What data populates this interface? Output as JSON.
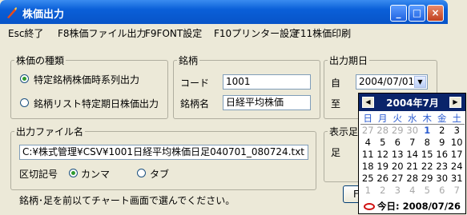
{
  "window": {
    "title": "株価出力",
    "min_label": "_",
    "max_label": "□",
    "close_label": "×"
  },
  "menu": {
    "items": [
      "Esc終了",
      "F8株価ファイル出力",
      "F9FONT設定",
      "F10プリンター設定",
      "F11株価印刷"
    ]
  },
  "stock_type": {
    "legend": "株価の種類",
    "option1": "特定銘柄株価時系列出力",
    "option2": "銘柄リスト特定期日株価出力",
    "selected": 0
  },
  "issue": {
    "legend": "銘柄",
    "code_label": "コード",
    "code_value": "1001",
    "name_label": "銘柄名",
    "name_value": "日経平均株価"
  },
  "period": {
    "legend": "出力期日",
    "from_label": "自",
    "from_value": "2004/07/01",
    "to_label": "至",
    "dropdown_arrow": "▼"
  },
  "display": {
    "legend": "表示足",
    "foot_label": "足"
  },
  "output_file": {
    "legend": "出力ファイル名",
    "path": "C:¥株式管理¥CSV¥1001日経平均株価日足040701_080724.txt",
    "delimiter_label": "区切記号",
    "comma": "カンマ",
    "tab": "タブ",
    "selected": "comma"
  },
  "status": {
    "message": "銘柄･足を前以てチャート画面で選んでください。"
  },
  "bottom_button": {
    "label": "F"
  },
  "calendar": {
    "title": "2004年7月",
    "prev": "◀",
    "next": "▶",
    "weekdays": [
      "日",
      "月",
      "火",
      "水",
      "木",
      "金",
      "土"
    ],
    "weeks": [
      [
        "27",
        "28",
        "29",
        "30",
        "1",
        "2",
        "3"
      ],
      [
        "4",
        "5",
        "6",
        "7",
        "8",
        "9",
        "10"
      ],
      [
        "11",
        "12",
        "13",
        "14",
        "15",
        "16",
        "17"
      ],
      [
        "18",
        "19",
        "20",
        "21",
        "22",
        "23",
        "24"
      ],
      [
        "25",
        "26",
        "27",
        "28",
        "29",
        "30",
        "31"
      ],
      [
        "1",
        "2",
        "3",
        "4",
        "5",
        "6",
        "7"
      ]
    ],
    "selected_day": "1",
    "today_label": "今日: 2008/07/26"
  },
  "colors": {
    "titlebar": "#0854c8",
    "selection": "#2a5bd0",
    "today_circle": "#d01010"
  }
}
